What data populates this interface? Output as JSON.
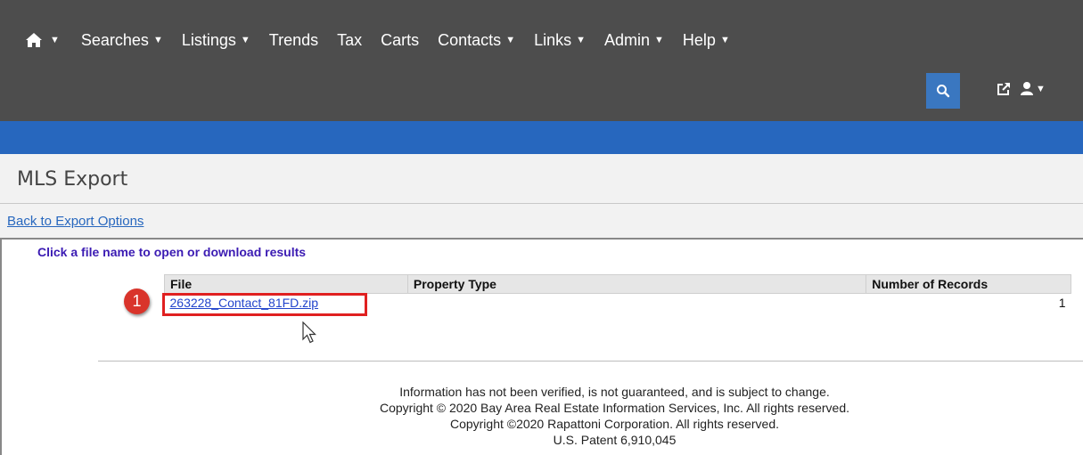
{
  "nav": {
    "items": [
      {
        "label": "Searches",
        "dropdown": true
      },
      {
        "label": "Listings",
        "dropdown": true
      },
      {
        "label": "Trends",
        "dropdown": false
      },
      {
        "label": "Tax",
        "dropdown": false
      },
      {
        "label": "Carts",
        "dropdown": false
      },
      {
        "label": "Contacts",
        "dropdown": true
      },
      {
        "label": "Links",
        "dropdown": true
      },
      {
        "label": "Admin",
        "dropdown": true
      },
      {
        "label": "Help",
        "dropdown": true
      }
    ],
    "icons": [
      "home-icon",
      "search-icon",
      "external-link-icon",
      "user-icon"
    ],
    "colors": {
      "topbar": "#4d4d4d",
      "bluebar": "#2767be",
      "search_button": "#3a77c0"
    }
  },
  "page": {
    "title": "MLS Export",
    "back_link": "Back to Export Options",
    "instruction": "Click a file name to open or download results"
  },
  "table": {
    "headers": {
      "file": "File",
      "property_type": "Property Type",
      "records": "Number of Records"
    },
    "rows": [
      {
        "file": "263228_Contact_81FD.zip",
        "property_type": "",
        "records": "1"
      }
    ]
  },
  "annotation": {
    "step": "1",
    "color": "#d9342b"
  },
  "footer": {
    "line1": "Information has not been verified, is not guaranteed, and is subject to change.",
    "line2": "Copyright © 2020 Bay Area Real Estate Information Services, Inc. All rights reserved.",
    "line3": "Copyright ©2020 Rapattoni Corporation. All rights reserved.",
    "line4": "U.S. Patent 6,910,045"
  }
}
